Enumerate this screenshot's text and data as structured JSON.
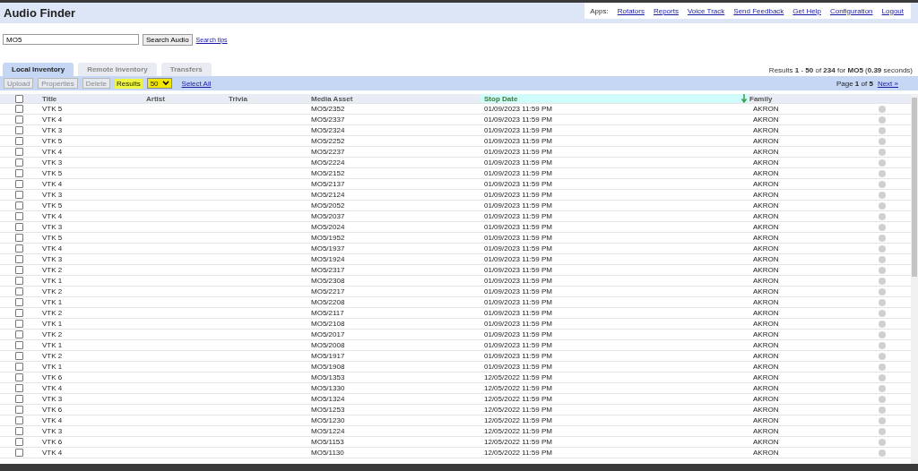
{
  "app_title": "Audio Finder",
  "apps_label": "Apps:",
  "nav_links": [
    "Rotators",
    "Reports",
    "Voice Track",
    "Send Feedback",
    "Get Help",
    "Configuration",
    "Logout"
  ],
  "search": {
    "value": "MO5",
    "button": "Search Audio",
    "tips_link": "Search tips"
  },
  "tabs": [
    {
      "label": "Local Inventory",
      "selected": true
    },
    {
      "label": "Remote Inventory",
      "selected": false
    },
    {
      "label": "Transfers",
      "selected": false
    }
  ],
  "results_summary": "Results **1** - **50** of **234** for **MO5** (**0.39** seconds)",
  "toolbar": {
    "buttons": [
      {
        "label": "Upload",
        "disabled": true
      },
      {
        "label": "Properties",
        "disabled": true
      },
      {
        "label": "Delete",
        "disabled": true
      }
    ],
    "results_label": "Results",
    "results_select": "50",
    "select_all": "Select All",
    "page_info": "Page **1** of **5**",
    "next_link": "Next »"
  },
  "table": {
    "all_checked": false,
    "columns": [
      {
        "label": "Title",
        "sorted": false
      },
      {
        "label": "Artist",
        "sorted": false
      },
      {
        "label": "Trivia",
        "sorted": false
      },
      {
        "label": "Media Asset",
        "sorted": false
      },
      {
        "label": "Stop Date",
        "sorted": true
      },
      {
        "label": "Family",
        "sorted": false,
        "sort_arrow": true
      }
    ],
    "rows": [
      {
        "checked": false,
        "title": "VTK 5",
        "asset": "MO5/2352",
        "stop_date": "01/09/2023 11:59 PM",
        "family": "AKRON"
      },
      {
        "checked": false,
        "title": "VTK 4",
        "asset": "MO5/2337",
        "stop_date": "01/09/2023 11:59 PM",
        "family": "AKRON"
      },
      {
        "checked": false,
        "title": "VTK 3",
        "asset": "MO5/2324",
        "stop_date": "01/09/2023 11:59 PM",
        "family": "AKRON"
      },
      {
        "checked": false,
        "title": "VTK 5",
        "asset": "MO5/2252",
        "stop_date": "01/09/2023 11:59 PM",
        "family": "AKRON"
      },
      {
        "checked": false,
        "title": "VTK 4",
        "asset": "MO5/2237",
        "stop_date": "01/09/2023 11:59 PM",
        "family": "AKRON"
      },
      {
        "checked": false,
        "title": "VTK 3",
        "asset": "MO5/2224",
        "stop_date": "01/09/2023 11:59 PM",
        "family": "AKRON"
      },
      {
        "checked": false,
        "title": "VTK 5",
        "asset": "MO5/2152",
        "stop_date": "01/09/2023 11:59 PM",
        "family": "AKRON"
      },
      {
        "checked": false,
        "title": "VTK 4",
        "asset": "MO5/2137",
        "stop_date": "01/09/2023 11:59 PM",
        "family": "AKRON"
      },
      {
        "checked": false,
        "title": "VTK 3",
        "asset": "MO5/2124",
        "stop_date": "01/09/2023 11:59 PM",
        "family": "AKRON"
      },
      {
        "checked": false,
        "title": "VTK 5",
        "asset": "MO5/2052",
        "stop_date": "01/09/2023 11:59 PM",
        "family": "AKRON"
      },
      {
        "checked": false,
        "title": "VTK 4",
        "asset": "MO5/2037",
        "stop_date": "01/09/2023 11:59 PM",
        "family": "AKRON"
      },
      {
        "checked": false,
        "title": "VTK 3",
        "asset": "MO5/2024",
        "stop_date": "01/09/2023 11:59 PM",
        "family": "AKRON"
      },
      {
        "checked": false,
        "title": "VTK 5",
        "asset": "MO5/1952",
        "stop_date": "01/09/2023 11:59 PM",
        "family": "AKRON"
      },
      {
        "checked": false,
        "title": "VTK 4",
        "asset": "MO5/1937",
        "stop_date": "01/09/2023 11:59 PM",
        "family": "AKRON"
      },
      {
        "checked": false,
        "title": "VTK 3",
        "asset": "MO5/1924",
        "stop_date": "01/09/2023 11:59 PM",
        "family": "AKRON"
      },
      {
        "checked": false,
        "title": "VTK 2",
        "asset": "MO5/2317",
        "stop_date": "01/09/2023 11:59 PM",
        "family": "AKRON"
      },
      {
        "checked": false,
        "title": "VTK 1",
        "asset": "MO5/2308",
        "stop_date": "01/09/2023 11:59 PM",
        "family": "AKRON"
      },
      {
        "checked": false,
        "title": "VTK 2",
        "asset": "MO5/2217",
        "stop_date": "01/09/2023 11:59 PM",
        "family": "AKRON"
      },
      {
        "checked": false,
        "title": "VTK 1",
        "asset": "MO5/2208",
        "stop_date": "01/09/2023 11:59 PM",
        "family": "AKRON"
      },
      {
        "checked": false,
        "title": "VTK 2",
        "asset": "MO5/2117",
        "stop_date": "01/09/2023 11:59 PM",
        "family": "AKRON"
      },
      {
        "checked": false,
        "title": "VTK 1",
        "asset": "MO5/2108",
        "stop_date": "01/09/2023 11:59 PM",
        "family": "AKRON"
      },
      {
        "checked": false,
        "title": "VTK 2",
        "asset": "MO5/2017",
        "stop_date": "01/09/2023 11:59 PM",
        "family": "AKRON"
      },
      {
        "checked": false,
        "title": "VTK 1",
        "asset": "MO5/2008",
        "stop_date": "01/09/2023 11:59 PM",
        "family": "AKRON"
      },
      {
        "checked": false,
        "title": "VTK 2",
        "asset": "MO5/1917",
        "stop_date": "01/09/2023 11:59 PM",
        "family": "AKRON"
      },
      {
        "checked": false,
        "title": "VTK 1",
        "asset": "MO5/1908",
        "stop_date": "01/09/2023 11:59 PM",
        "family": "AKRON"
      },
      {
        "checked": false,
        "title": "VTK 6",
        "asset": "MO5/1353",
        "stop_date": "12/05/2022 11:59 PM",
        "family": "AKRON"
      },
      {
        "checked": false,
        "title": "VTK 4",
        "asset": "MO5/1330",
        "stop_date": "12/05/2022 11:59 PM",
        "family": "AKRON"
      },
      {
        "checked": false,
        "title": "VTK 3",
        "asset": "MO5/1324",
        "stop_date": "12/05/2022 11:59 PM",
        "family": "AKRON"
      },
      {
        "checked": false,
        "title": "VTK 6",
        "asset": "MO5/1253",
        "stop_date": "12/05/2022 11:59 PM",
        "family": "AKRON"
      },
      {
        "checked": false,
        "title": "VTK 4",
        "asset": "MO5/1230",
        "stop_date": "12/05/2022 11:59 PM",
        "family": "AKRON"
      },
      {
        "checked": false,
        "title": "VTK 3",
        "asset": "MO5/1224",
        "stop_date": "12/05/2022 11:59 PM",
        "family": "AKRON"
      },
      {
        "checked": false,
        "title": "VTK 6",
        "asset": "MO5/1153",
        "stop_date": "12/05/2022 11:59 PM",
        "family": "AKRON"
      },
      {
        "checked": false,
        "title": "VTK 4",
        "asset": "MO5/1130",
        "stop_date": "12/05/2022 11:59 PM",
        "family": "AKRON"
      }
    ]
  }
}
